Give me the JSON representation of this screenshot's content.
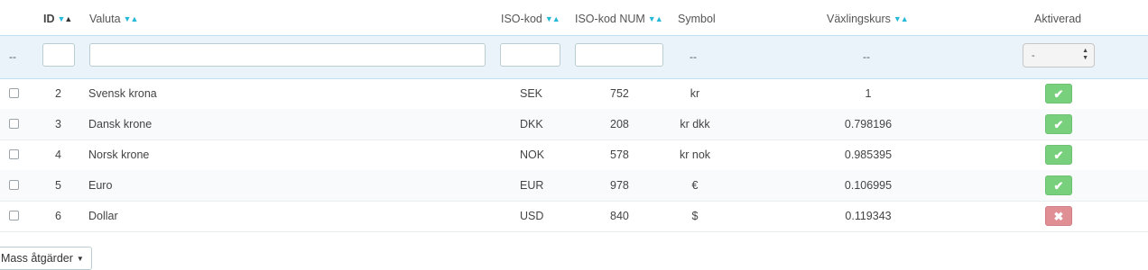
{
  "columns": {
    "id": "ID",
    "currency": "Valuta",
    "iso": "ISO-kod",
    "iso_num": "ISO-kod NUM",
    "symbol": "Symbol",
    "rate": "Växlingskurs",
    "enabled": "Aktiverad"
  },
  "sort_icons": {
    "down": "▼",
    "up": "▲"
  },
  "filters": {
    "bulk_placeholder": "--",
    "symbol_placeholder": "--",
    "rate_placeholder": "--",
    "enabled_select_value": "-"
  },
  "rows": [
    {
      "id": "2",
      "currency": "Svensk krona",
      "iso": "SEK",
      "iso_num": "752",
      "symbol": "kr",
      "rate": "1",
      "enabled": true,
      "enabled_icon": "✔"
    },
    {
      "id": "3",
      "currency": "Dansk krone",
      "iso": "DKK",
      "iso_num": "208",
      "symbol": "kr dkk",
      "rate": "0.798196",
      "enabled": true,
      "enabled_icon": "✔"
    },
    {
      "id": "4",
      "currency": "Norsk krone",
      "iso": "NOK",
      "iso_num": "578",
      "symbol": "kr nok",
      "rate": "0.985395",
      "enabled": true,
      "enabled_icon": "✔"
    },
    {
      "id": "5",
      "currency": "Euro",
      "iso": "EUR",
      "iso_num": "978",
      "symbol": "€",
      "rate": "0.106995",
      "enabled": true,
      "enabled_icon": "✔"
    },
    {
      "id": "6",
      "currency": "Dollar",
      "iso": "USD",
      "iso_num": "840",
      "symbol": "$",
      "rate": "0.119343",
      "enabled": false,
      "enabled_icon": "✖"
    }
  ],
  "bulk_actions": {
    "label": "Mass åtgärder",
    "caret": "▼"
  },
  "colors": {
    "accent": "#25b9d7",
    "enabled": "#78d07d",
    "disabled": "#e08f95",
    "filter_bg": "#eaf3fa"
  }
}
